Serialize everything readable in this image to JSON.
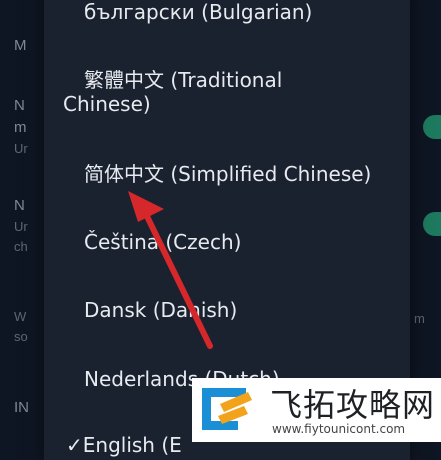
{
  "background": {
    "labels": [
      {
        "text": "M",
        "dim": false
      },
      {
        "text": "N",
        "dim": false
      },
      {
        "text": "m",
        "dim": false
      },
      {
        "text": "Ur",
        "dim": true
      },
      {
        "text": "N",
        "dim": false
      },
      {
        "text": "Ur",
        "dim": true
      },
      {
        "text": "ch",
        "dim": true
      },
      {
        "text": "W",
        "dim": true
      },
      {
        "text": "so",
        "dim": true
      },
      {
        "text": "IN",
        "dim": false
      }
    ],
    "right_labels": [
      "m"
    ],
    "toggle_color": "#1e7a5e"
  },
  "language_dialog": {
    "items": [
      {
        "line1": "български (Bulgarian)"
      },
      {
        "line1": "繁體中文 (Traditional",
        "line2": "Chinese)"
      },
      {
        "line1": "简体中文 (Simplified Chinese)"
      },
      {
        "line1": "Čeština (Czech)"
      },
      {
        "line1": "Dansk (Danish)"
      },
      {
        "line1": "Nederlands (Dutch)"
      },
      {
        "line1": "✓English (E"
      }
    ]
  },
  "annotation": {
    "arrow_color": "#d6282b"
  },
  "watermark": {
    "title": "飞拓攻略网",
    "url": "www.fiytounicont.com"
  }
}
